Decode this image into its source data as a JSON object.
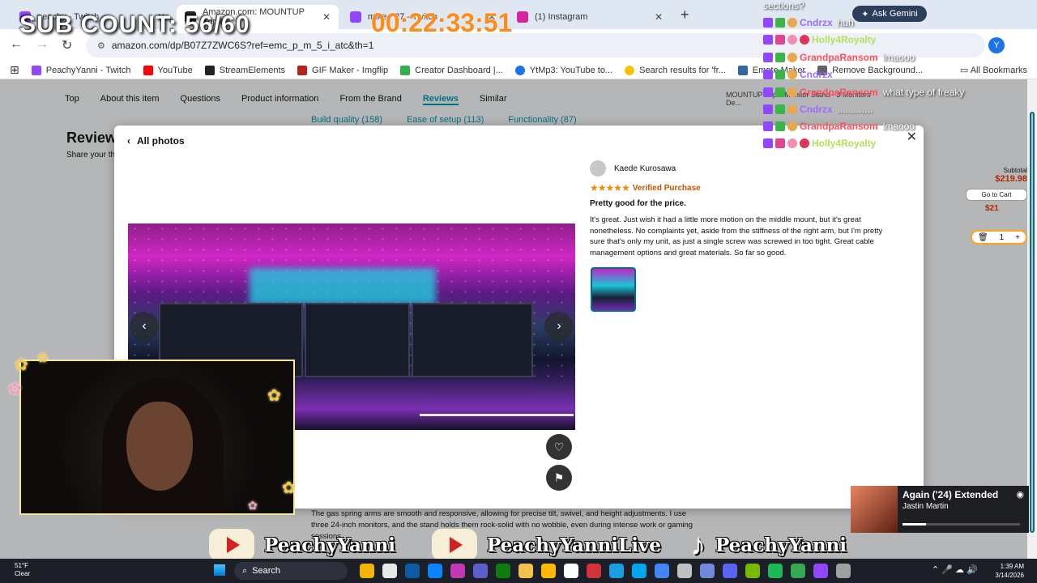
{
  "browser": {
    "tabs": [
      {
        "label": "peachy - Twitch",
        "fav": "#9146ff"
      },
      {
        "label": "Amazon.com: MOUNTUP Triple",
        "fav": "#222222"
      },
      {
        "label": "mike - 27 - Twitch",
        "fav": "#9146ff"
      },
      {
        "label": "(1) Instagram",
        "fav": "#d6249f"
      }
    ],
    "url": "amazon.com/dp/B07Z7ZWC6S?ref=emc_p_m_5_i_atc&th=1",
    "profile": "Y",
    "ask_gemini": "Ask Gemini",
    "bookmarks": [
      {
        "label": "PeachyYanni - Twitch",
        "color": "#9146ff"
      },
      {
        "label": "YouTube",
        "color": "#ff0000"
      },
      {
        "label": "StreamElements",
        "color": "#222222"
      },
      {
        "label": "GIF Maker - Imgflip",
        "color": "#b5241a"
      },
      {
        "label": "Creator Dashboard |...",
        "color": "#2fb34a"
      },
      {
        "label": "YtMp3: YouTube to...",
        "color": "#1a73e8"
      },
      {
        "label": "Search results for 'fr...",
        "color": "#f4c400"
      },
      {
        "label": "Emote Maker",
        "color": "#3465a4"
      },
      {
        "label": "Remove Background...",
        "color": "#5f6368"
      }
    ],
    "all_bookmarks": "All Bookmarks"
  },
  "amazon": {
    "subnav": [
      "Top",
      "About this item",
      "Questions",
      "Product information",
      "From the Brand",
      "Reviews",
      "Similar"
    ],
    "filters": [
      "Build quality (158)",
      "Ease of setup (113)",
      "Functionality (87)"
    ],
    "review_heading": "Review",
    "share_text": "Share your th",
    "side": {
      "title": "MOUNTUP Triple Monitor Stand - 3 Monitors De...",
      "subtotal_label": "Subtotal",
      "price": "$219.98",
      "cart": "Go to Cart",
      "price2": "$21",
      "qty": "1"
    },
    "below_text": "The gas spring arms are smooth and responsive, allowing for precise tilt, swivel, and height adjustments. I use three 24-inch monitors, and the stand holds them rock-solid with no wobble, even during intense work or gaming sessions."
  },
  "modal": {
    "all_photos": "All photos",
    "reviewer": "Kaede Kurosawa",
    "stars": "★★★★★",
    "verified": "Verified Purchase",
    "title": "Pretty good for the price.",
    "body": "It's great. Just wish it had a little more motion on the middle mount, but it's great nonetheless. No complaints yet, aside from the stiffness of the right arm, but I'm pretty sure that's only my unit, as just a single screw was screwed in too tight. Great cable management options and great materials. So far so good."
  },
  "overlay": {
    "sub_count": "SUB COUNT: 56/60",
    "timer": "00:22:33:51",
    "chat_question": "sections?",
    "chat": [
      {
        "user": "Cndrzx",
        "color": "#9b6cff",
        "msg": "huh"
      },
      {
        "user": "Holly4Royalty",
        "color": "#b4e05a",
        "msg": ""
      },
      {
        "user": "GrandpaRansom",
        "color": "#ff4d5a",
        "msg": "lmaooo"
      },
      {
        "user": "Cndrzx",
        "color": "#9b6cff",
        "msg": ""
      },
      {
        "user": "GrandpaRansom",
        "color": "#ff4d5a",
        "msg": "what type of freaky"
      },
      {
        "user": "Cndrzx",
        "color": "#9b6cff",
        "msg": "............."
      },
      {
        "user": "GrandpaRansom",
        "color": "#ff4d5a",
        "msg": "lmaooo"
      },
      {
        "user": "Holly4Royalty",
        "color": "#b4e05a",
        "msg": ""
      }
    ],
    "socials": [
      "PeachyYanni",
      "PeachyYanniLive",
      "PeachyYanni"
    ],
    "music": {
      "title": "Again ('24) Extended",
      "artist": "Jastin Martin",
      "progress": 0.2
    }
  },
  "taskbar": {
    "temp": "51°F",
    "weather": "Clear",
    "search": "Search",
    "time": "1:39 AM",
    "date": "3/14/2026",
    "app_colors": [
      "#f4b400",
      "#e8e8e8",
      "#0c59a4",
      "#0a84ff",
      "#c239b3",
      "#5b5fc7",
      "#107c10",
      "#f2c14e",
      "#ffb900",
      "#ffffff",
      "#d13438",
      "#1b9de2",
      "#00a4ef",
      "#4285f4",
      "#c0c0c0",
      "#7289da",
      "#5865f2",
      "#76b900",
      "#1db954",
      "#34a853",
      "#9146ff",
      "#a0a0a0"
    ]
  }
}
